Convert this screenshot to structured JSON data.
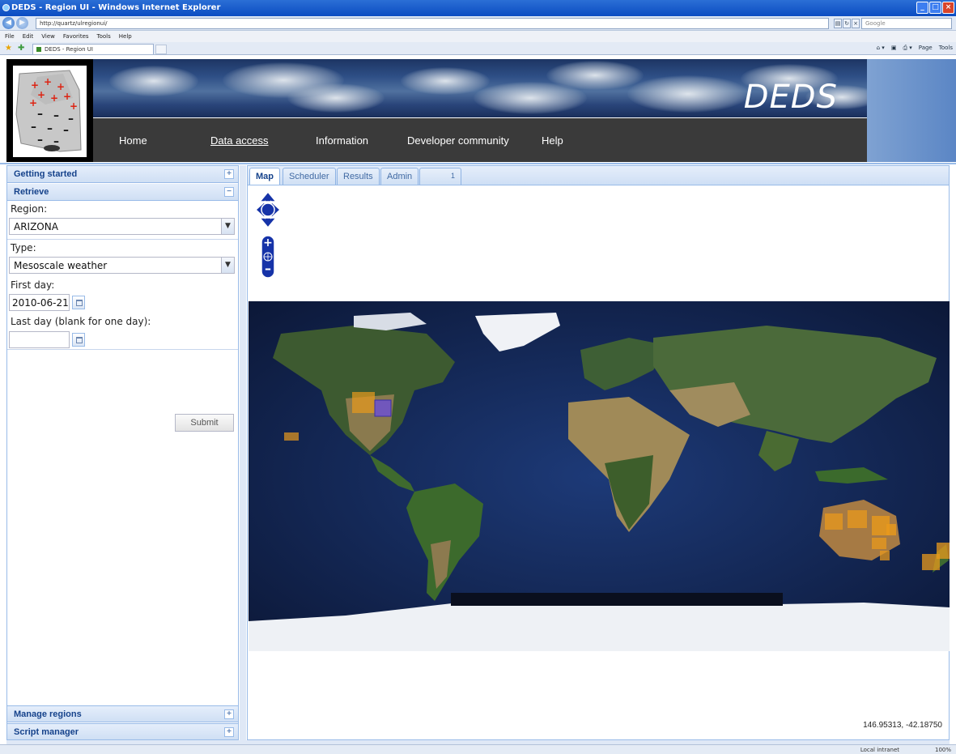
{
  "browser": {
    "window_title": "DEDS - Region UI - Windows Internet Explorer",
    "address": "http://quartz/ulregionui/",
    "search_placeholder": "Google",
    "tab_title": "DEDS - Region UI",
    "menu": [
      "File",
      "Edit",
      "View",
      "Favorites",
      "Tools",
      "Help"
    ],
    "commands": [
      "Page",
      "Tools"
    ],
    "status_zone": "Local intranet",
    "status_zoom": "100%"
  },
  "header": {
    "site_title": "DEDS",
    "nav": [
      {
        "label": "Home"
      },
      {
        "label": "Data access"
      },
      {
        "label": "Information"
      },
      {
        "label": "Developer community"
      },
      {
        "label": "Help"
      }
    ]
  },
  "sidebar": {
    "getting_started": "Getting started",
    "retrieve": "Retrieve",
    "manage_regions": "Manage regions",
    "script_manager": "Script manager",
    "form": {
      "region_label": "Region:",
      "region_value": "ARIZONA",
      "type_label": "Type:",
      "type_value": "Mesoscale weather",
      "first_day_label": "First day:",
      "first_day_value": "2010-06-21",
      "last_day_label": "Last day (blank for one day):",
      "last_day_value": "",
      "submit_label": "Submit"
    }
  },
  "tabs": [
    {
      "label": "Map",
      "active": true
    },
    {
      "label": "Scheduler",
      "active": false
    },
    {
      "label": "Results",
      "active": false
    },
    {
      "label": "Admin",
      "active": false
    },
    {
      "label": "1",
      "active": false
    }
  ],
  "map": {
    "coordinates": "146.95313, -42.18750",
    "region_colors": {
      "orange": "#e89a1c",
      "highlight": "#6a4fd8"
    }
  }
}
